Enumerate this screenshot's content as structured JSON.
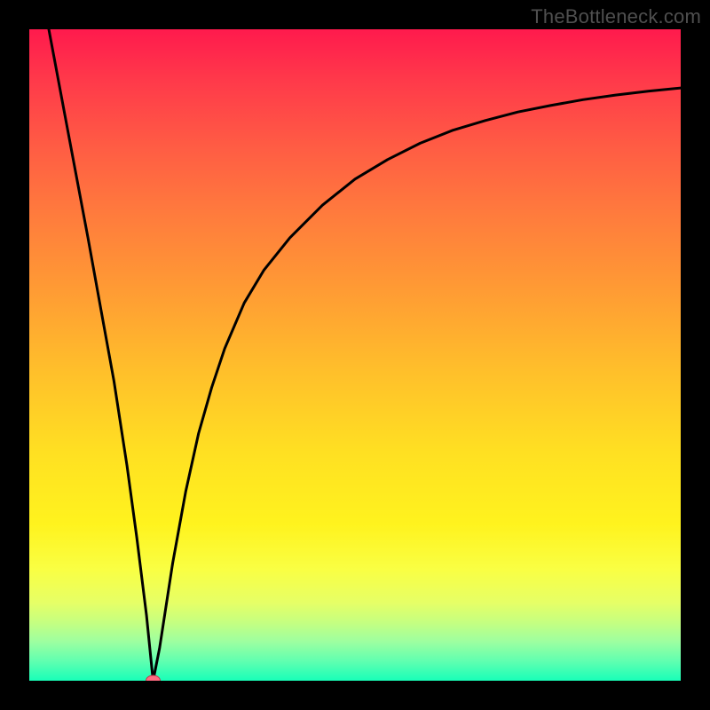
{
  "watermark": "TheBottleneck.com",
  "chart_data": {
    "type": "line",
    "title": "",
    "xlabel": "",
    "ylabel": "",
    "xlim": [
      0,
      100
    ],
    "ylim": [
      0,
      100
    ],
    "grid": false,
    "legend": false,
    "note": "Background is a vertical gradient from red (top / high bottleneck) through orange/yellow to green (bottom / no bottleneck). A single black curve descends steeply from top-left to a minimum near x≈19 (y≈0), then rises with diminishing slope toward the top-right. A small red/pink marker sits at the curve minimum.",
    "series": [
      {
        "name": "bottleneck-curve",
        "color": "#000000",
        "x": [
          3,
          6,
          9,
          11,
          13,
          15,
          16.5,
          18,
          19,
          20,
          22,
          24,
          26,
          28,
          30,
          33,
          36,
          40,
          45,
          50,
          55,
          60,
          65,
          70,
          75,
          80,
          85,
          90,
          95,
          100
        ],
        "y": [
          100,
          84,
          68,
          57,
          46,
          33,
          22,
          10,
          0,
          5,
          18,
          29,
          38,
          45,
          51,
          58,
          63,
          68,
          73,
          77,
          80,
          82.5,
          84.5,
          86,
          87.3,
          88.3,
          89.2,
          89.9,
          90.5,
          91
        ]
      }
    ],
    "marker": {
      "x": 19,
      "y": 0,
      "color": "#ff6b81"
    }
  }
}
